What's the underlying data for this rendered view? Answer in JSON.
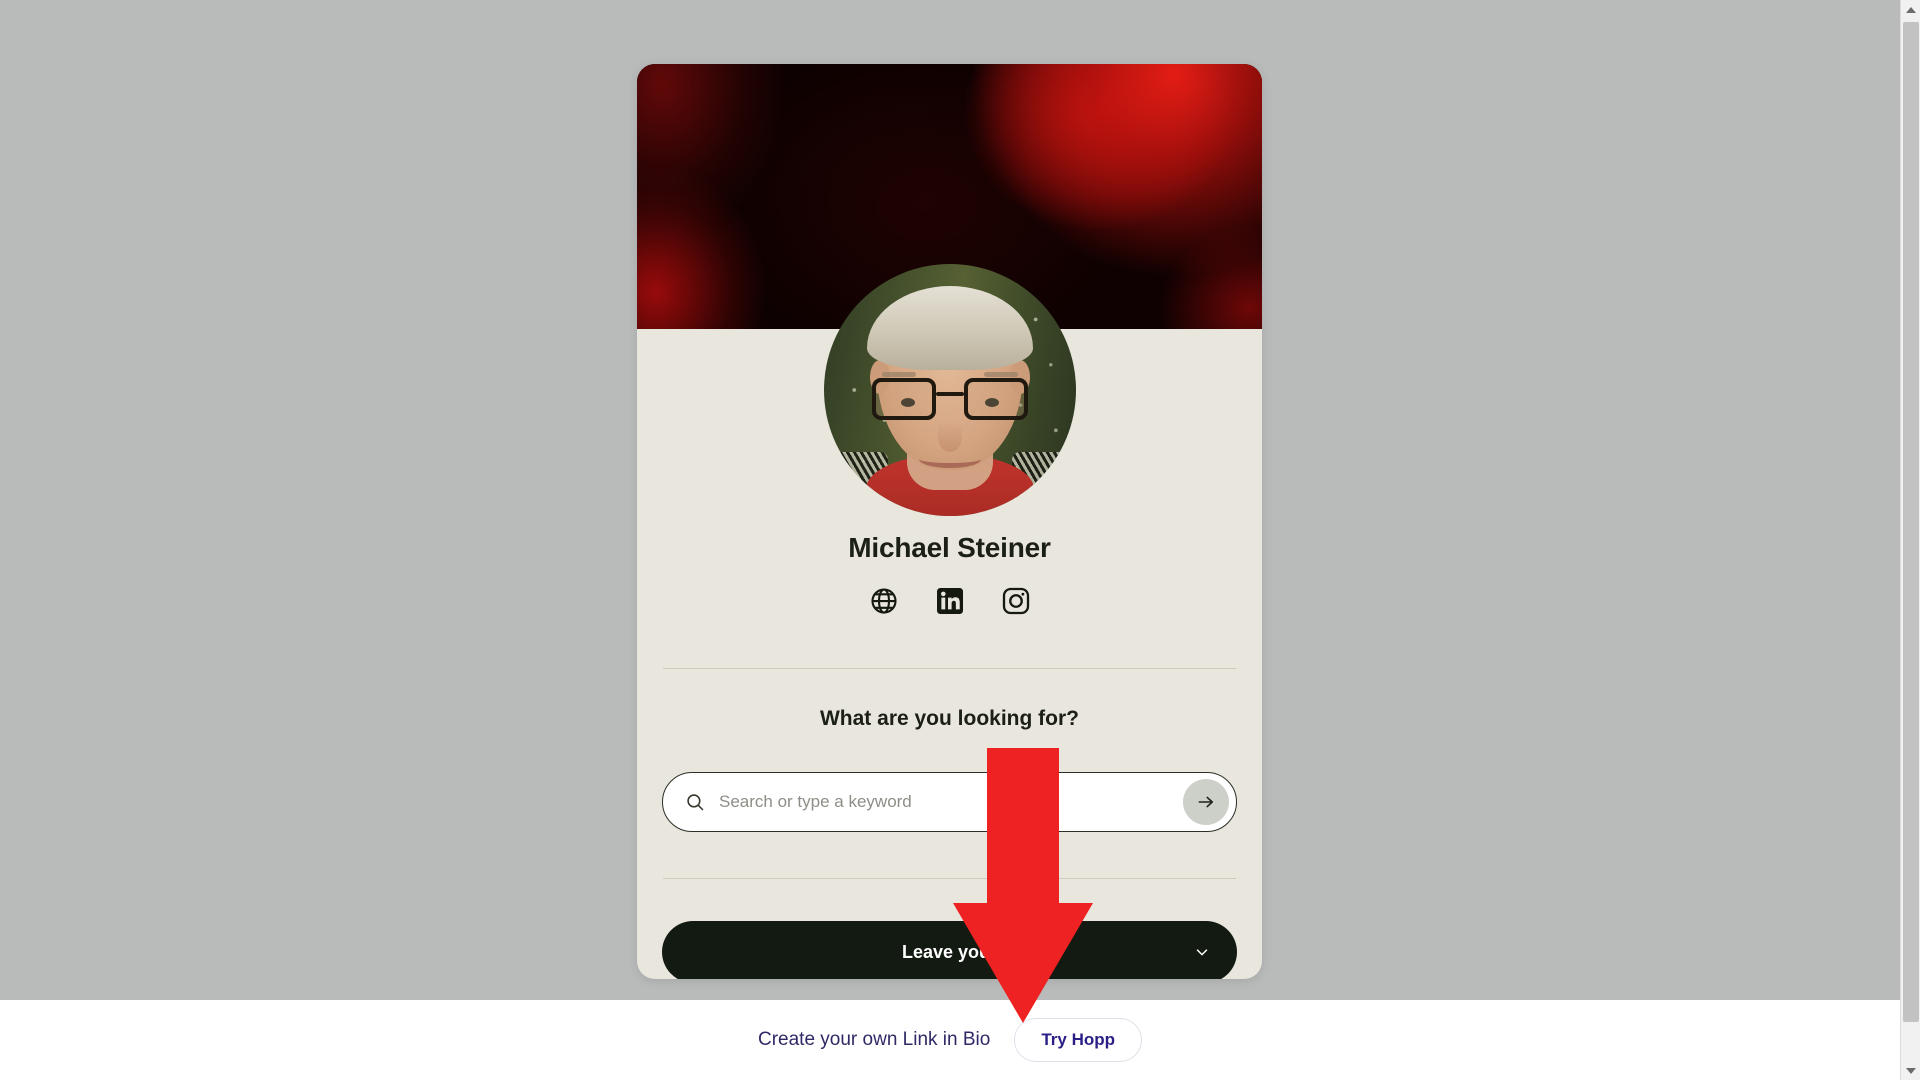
{
  "page": {
    "background_color": "#b9bbbb"
  },
  "card": {
    "background_color": "#e8e6dd",
    "banner": {
      "name": "profile-banner",
      "description": "dark red and black bokeh banner image",
      "colors": [
        "#0a0101",
        "#1d0303",
        "#cd1610",
        "#eb1e16"
      ]
    },
    "avatar": {
      "name": "profile-avatar",
      "description": "portrait of a man with grey hair, black-rimmed glasses and a red shirt, in front of greenery with string lights"
    },
    "profile_name": "Michael Steiner",
    "socials": [
      {
        "icon": "globe-icon",
        "label": "Website"
      },
      {
        "icon": "linkedin-icon",
        "label": "LinkedIn"
      },
      {
        "icon": "instagram-icon",
        "label": "Instagram"
      }
    ],
    "search": {
      "title": "What are you looking for?",
      "placeholder": "Search or type a keyword",
      "value": "",
      "icon": "search-icon",
      "submit_icon": "arrow-right-icon",
      "submit_label": "Search"
    },
    "cta": {
      "label": "Leave your",
      "chevron_icon": "chevron-down-icon"
    }
  },
  "footer": {
    "text": "Create your own Link in Bio",
    "button_label": "Try Hopp",
    "text_color": "#2f2a66",
    "button_text_color": "#2a1f86"
  },
  "annotation": {
    "name": "red-down-arrow",
    "color": "#ee2222",
    "direction": "down"
  },
  "scrollbar": {
    "up_icon": "scroll-up-arrow-icon",
    "down_icon": "scroll-down-arrow-icon",
    "thumb": "scrollbar-thumb"
  }
}
